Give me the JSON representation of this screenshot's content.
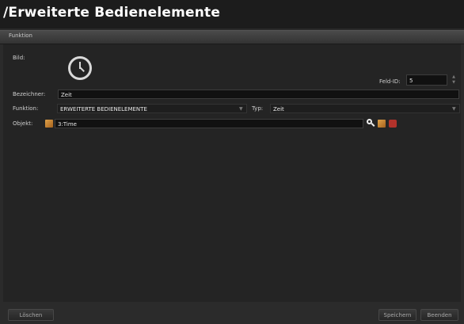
{
  "window": {
    "title": "/Erweiterte Bedienelemente"
  },
  "section": {
    "label": "Funktion"
  },
  "form": {
    "bild_label": "Bild:",
    "feld_id_label": "Feld-ID:",
    "feld_id_value": "5",
    "bezeichner_label": "Bezeichner:",
    "bezeichner_value": "Zeit",
    "funktion_label": "Funktion:",
    "funktion_value": "ERWEITERTE BEDIENELEMENTE",
    "typ_label": "Typ:",
    "typ_value": "Zeit",
    "objekt_label": "Objekt:",
    "objekt_value": "3:Time"
  },
  "icons": {
    "bild": "clock-icon",
    "objekt": "package-icon",
    "search": "search-icon",
    "assign": "package-icon",
    "remove": "remove-icon"
  },
  "buttons": {
    "delete": "Löschen",
    "save": "Speichern",
    "close": "Beenden"
  },
  "colors": {
    "background": "#2b2b2b",
    "titlebar": "#1c1c1c",
    "field": "#111111",
    "remove_icon": "#b2322b",
    "object_icon": "#d08a35"
  }
}
